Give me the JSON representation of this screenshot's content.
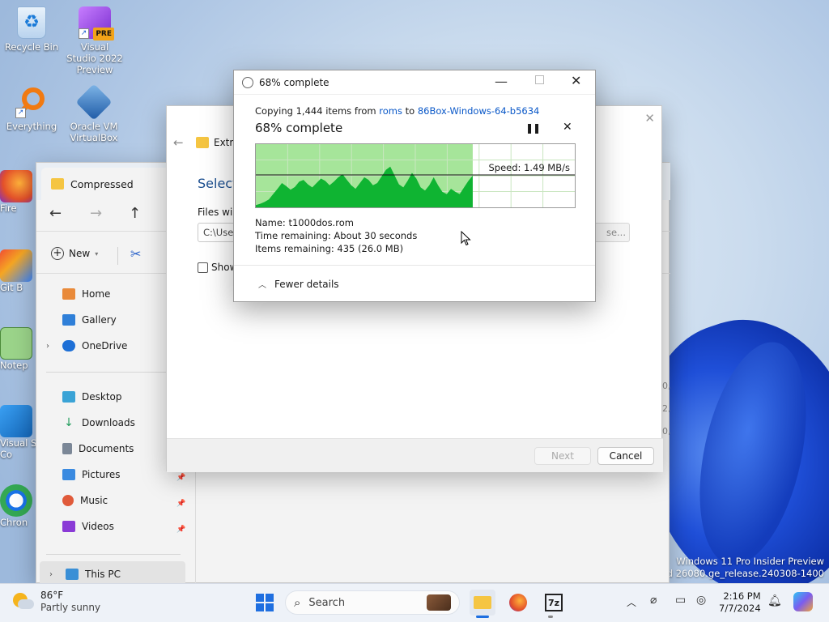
{
  "desktop": {
    "icons": [
      {
        "label": "Recycle Bin"
      },
      {
        "label": "Visual Studio 2022 Preview",
        "badge": "PRE"
      },
      {
        "label": "Everything"
      },
      {
        "label": "Oracle VM VirtualBox"
      },
      {
        "label": "Fire"
      },
      {
        "label": "Git B"
      },
      {
        "label": "Notep"
      },
      {
        "label": "Visual S Co"
      },
      {
        "label": "Chron"
      }
    ],
    "watermark_line1": "Windows 11 Pro Insider Preview",
    "watermark_line2": ". Build 26080.ge_release.240308-1400"
  },
  "explorer": {
    "tab_title": "Compressed",
    "new_label": "New",
    "nav": [
      {
        "label": "Home",
        "icon": "home-icon"
      },
      {
        "label": "Gallery",
        "icon": "gallery-icon"
      },
      {
        "label": "OneDrive",
        "icon": "cloud-icon"
      },
      {
        "label": "Desktop",
        "icon": "desktop-icon"
      },
      {
        "label": "Downloads",
        "icon": "download-icon"
      },
      {
        "label": "Documents",
        "icon": "document-icon"
      },
      {
        "label": "Pictures",
        "icon": "picture-icon"
      },
      {
        "label": "Music",
        "icon": "music-icon"
      },
      {
        "label": "Videos",
        "icon": "video-icon"
      },
      {
        "label": "This PC",
        "icon": "pc-icon"
      }
    ],
    "right_fragments": [
      "0,5",
      "2,0",
      "0,"
    ]
  },
  "wizard": {
    "title_fragment": "Extra",
    "heading_fragment": "Select",
    "files_label_fragment": "Files will",
    "path_fragment": "C:\\User",
    "browse_fragment": "se...",
    "show_fragment": "Show",
    "next_label": "Next",
    "cancel_label": "Cancel"
  },
  "progress": {
    "title": "68% complete",
    "copy_prefix": "Copying 1,444 items from",
    "source": "roms",
    "copy_to": "to",
    "destination": "86Box-Windows-64-b5634",
    "heading": "68% complete",
    "percent": 68,
    "speed_label": "Speed: 1.49 MB/s",
    "name_line": "Name: t1000dos.rom",
    "time_line": "Time remaining:  About 30 seconds",
    "items_line": "Items remaining:  435 (26.0 MB)",
    "details_toggle": "Fewer details",
    "speed_history": [
      0.05,
      0.08,
      0.12,
      0.18,
      0.3,
      0.42,
      0.55,
      0.48,
      0.4,
      0.46,
      0.58,
      0.62,
      0.52,
      0.45,
      0.55,
      0.65,
      0.6,
      0.5,
      0.58,
      0.68,
      0.75,
      0.62,
      0.5,
      0.42,
      0.55,
      0.68,
      0.62,
      0.5,
      0.55,
      0.7,
      0.85,
      0.92,
      0.72,
      0.52,
      0.45,
      0.6,
      0.78,
      0.65,
      0.45,
      0.38,
      0.5,
      0.68,
      0.5,
      0.35,
      0.3,
      0.42,
      0.35,
      0.3,
      0.45,
      0.6,
      0.72
    ],
    "colors": {
      "graph_fill": "#0fb432",
      "graph_bg_done": "#a6e59a",
      "link": "#0a58c8"
    }
  },
  "taskbar": {
    "weather_temp": "86°F",
    "weather_desc": "Partly sunny",
    "search_placeholder": "Search",
    "time": "2:16 PM",
    "date": "7/7/2024",
    "seven_zip_label": "7z"
  }
}
